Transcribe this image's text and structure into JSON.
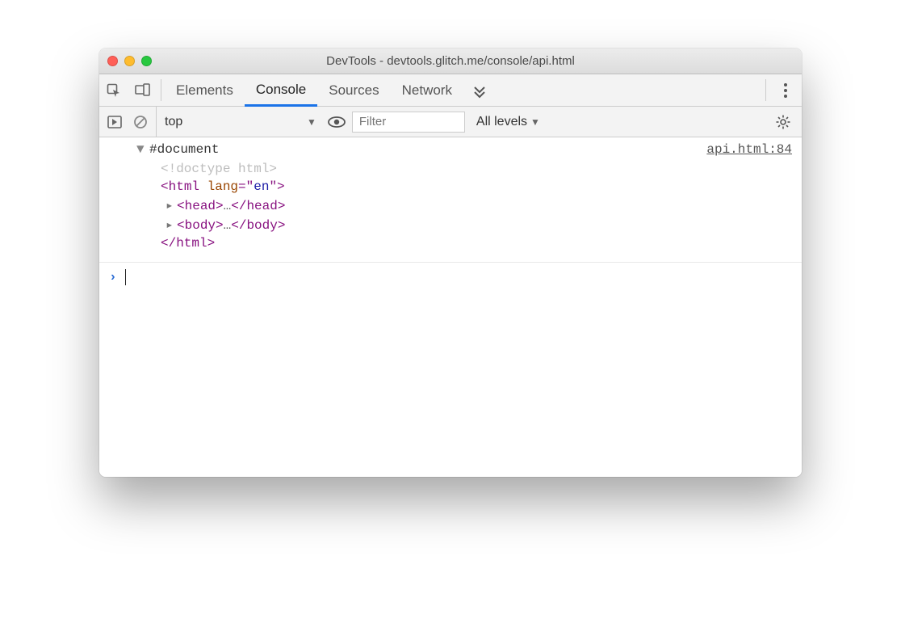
{
  "window": {
    "title": "DevTools - devtools.glitch.me/console/api.html"
  },
  "tabs": {
    "items": [
      {
        "label": "Elements"
      },
      {
        "label": "Console"
      },
      {
        "label": "Sources"
      },
      {
        "label": "Network"
      }
    ],
    "active_index": 1
  },
  "toolbar": {
    "context": "top",
    "filter_placeholder": "Filter",
    "levels_label": "All levels"
  },
  "source_link": "api.html:84",
  "tree": {
    "root_label": "#document",
    "doctype": "<!doctype html>",
    "html_open": {
      "tag": "html",
      "attr_name": "lang",
      "attr_value": "en"
    },
    "head": {
      "open": "head",
      "close": "head"
    },
    "body": {
      "open": "body",
      "close": "body"
    },
    "html_close": "html"
  }
}
